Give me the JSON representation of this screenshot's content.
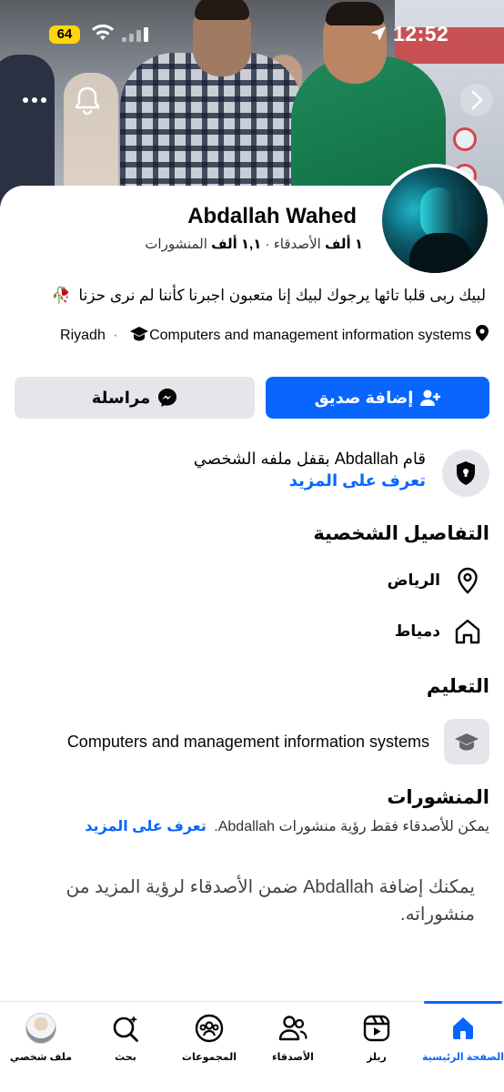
{
  "status_bar": {
    "battery": "64",
    "time": "12:52"
  },
  "profile": {
    "name": "Abdallah Wahed",
    "friends_count": "١ ألف",
    "friends_label": "الأصدقاء",
    "separator": " · ",
    "posts_count": "١,١ ألف",
    "posts_label": "المنشورات",
    "bio": "لبيك ربى قلبا تائها يرجوك لبيك إنا متعبون اجبرنا كأننا لم نرى حزنا",
    "bio_emoji": "🥀",
    "location": "Riyadh",
    "education": "Computers and management information systems"
  },
  "actions": {
    "add_friend": "إضافة صديق",
    "message": "مراسلة"
  },
  "lock_notice": {
    "text": "قام Abdallah بقفل ملفه الشخصي",
    "link": "تعرف على المزيد"
  },
  "details": {
    "title": "التفاصيل الشخصية",
    "items": [
      {
        "icon": "map-pin-icon",
        "label": "الرياض"
      },
      {
        "icon": "home-icon",
        "label": "دمياط"
      }
    ]
  },
  "education_section": {
    "title": "التعليم",
    "item": "Computers and management information systems"
  },
  "posts": {
    "title": "المنشورات",
    "subtitle": "يمكن للأصدقاء فقط رؤية منشورات Abdallah.",
    "link": "تعرف على المزيد",
    "note": "يمكنك إضافة Abdallah ضمن الأصدقاء لرؤية المزيد من منشوراته."
  },
  "bottom_nav": {
    "items": [
      {
        "label": "الصفحة الرئيسية",
        "icon": "home-icon",
        "active": true
      },
      {
        "label": "ريلز",
        "icon": "reels-icon"
      },
      {
        "label": "الأصدقاء",
        "icon": "friends-icon"
      },
      {
        "label": "المجموعات",
        "icon": "groups-icon"
      },
      {
        "label": "بحث",
        "icon": "search-icon"
      },
      {
        "label": "ملف شخصي",
        "icon": "profile-avatar"
      }
    ]
  },
  "colors": {
    "accent": "#0866ff",
    "secondary_button": "#e4e6eb",
    "battery": "#ffd60a"
  }
}
